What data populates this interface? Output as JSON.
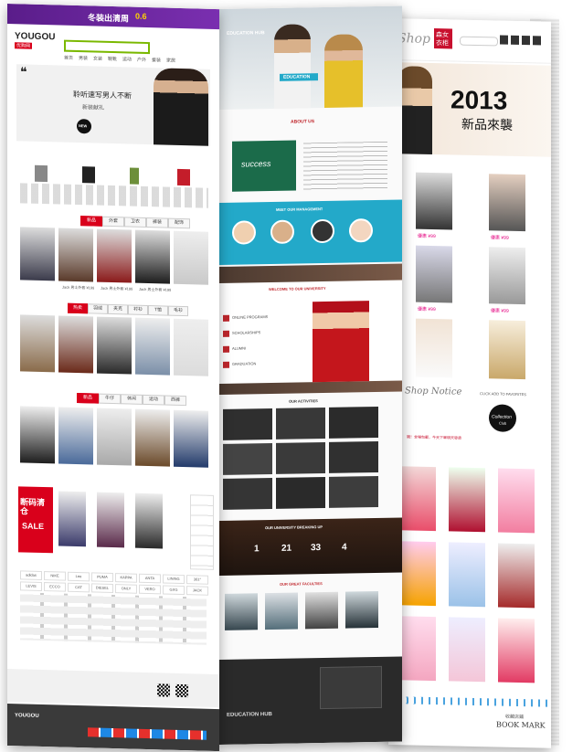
{
  "yougou": {
    "banner_text": "冬装出清周",
    "banner_badge": "0.6",
    "logo_main": "YOUGOU",
    "logo_sub": "优购网",
    "hero_quote_mark": "❝",
    "hero_slogan": "聆听速写男人不断",
    "hero_slogan_sub": "新装献礼",
    "hero_badge": "NEW",
    "nav_items": [
      "首页",
      "男装",
      "女装",
      "鞋靴",
      "运动",
      "户外",
      "童装",
      "家居"
    ],
    "section_tabs_1": [
      "新品",
      "外套",
      "卫衣",
      "裤装",
      "配饰"
    ],
    "section_tabs_2": [
      "热卖",
      "羽绒",
      "夹克",
      "衬衫",
      "T恤",
      "毛衫"
    ],
    "section_tabs_3": [
      "新品",
      "牛仔",
      "休闲",
      "运动",
      "西裤"
    ],
    "product_caption": "Jack 男士外套 ¥199",
    "sale_title": "断码清仓",
    "sale_en": "SALE",
    "brands": [
      "adidas",
      "NIKE",
      "Lee",
      "PUMA",
      "KAPPA",
      "ANTA",
      "LINING",
      "361°",
      "LEVIS",
      "ECCO",
      "CAT",
      "DIESEL",
      "ONLY",
      "VERO",
      "GXG",
      "JACK"
    ],
    "footer_brand": "YOUGOU"
  },
  "education": {
    "header_title": "EDUCATION HUB",
    "hero_label": "EDUCATION",
    "about_title": "ABOUT US",
    "success_word": "success",
    "management_title": "MEET OUR MANAGEMENT",
    "welcome_title": "WELCOME TO OUR UNIVERSITY",
    "list_items": [
      "ONLINE PROGRAMS",
      "SCHOLARSHIPS",
      "ALUMNI",
      "GRADUATION"
    ],
    "activities_title": "OUR ACTIVITIES",
    "stats_title": "OUR UNIVERSITY BREAKING UP",
    "stats": [
      "1",
      "21",
      "33",
      "4"
    ],
    "faculty_title": "OUR GREAT FACULTIES",
    "footer_title": "EDUCATION HUB"
  },
  "shop": {
    "logo": "Shop",
    "red_badge_top": "森女",
    "red_badge_bottom": "衣柜",
    "hero_year": "2013",
    "hero_subtitle": "新品來襲",
    "price_label": "優惠 ¥99",
    "notice_title": "Shop Notice",
    "collection_top": "Collection",
    "collection_sub": "Club",
    "favorite_text": "CLICK ADD TO FAVORITES",
    "bookmark_top": "收藏店鋪",
    "bookmark_main": "BOOK MARK",
    "promo_text": "親！全場包郵，今天下單明天發貨"
  },
  "colors": {
    "yougou_red": "#d9001b",
    "edu_teal": "#23a9c9",
    "edu_red": "#c0272d",
    "shop_pink": "#e4007f"
  }
}
